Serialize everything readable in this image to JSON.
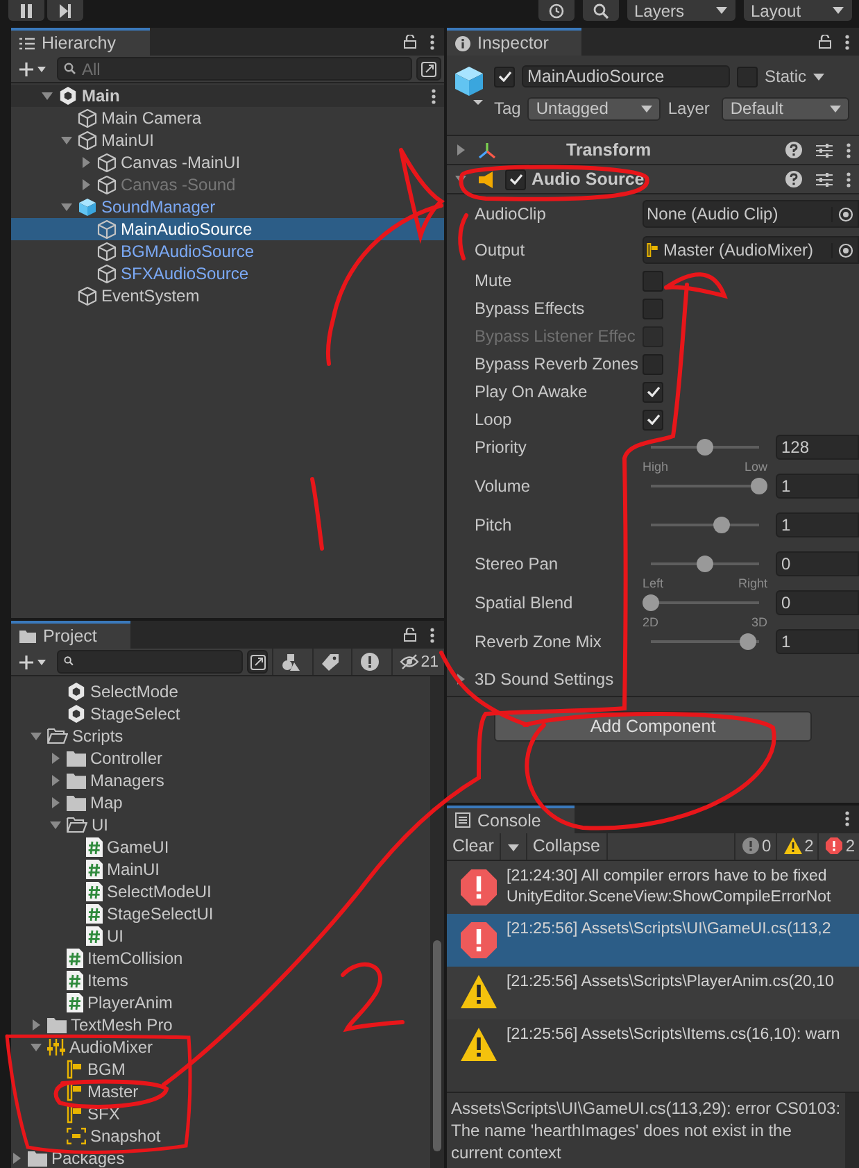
{
  "toolbar": {
    "layers": "Layers",
    "layout": "Layout"
  },
  "hierarchy": {
    "tab": "Hierarchy",
    "search": {
      "placeholder": "All"
    },
    "tree": [
      {
        "label": "Main",
        "kind": "scene",
        "expanded": true,
        "selected": false,
        "prefab_instance": false,
        "inactive": false,
        "children": [
          {
            "label": "Main Camera",
            "kind": "object",
            "selected": false,
            "prefab_instance": false,
            "inactive": false
          },
          {
            "label": "MainUI",
            "kind": "object",
            "expanded": true,
            "selected": false,
            "prefab_instance": false,
            "inactive": false,
            "children": [
              {
                "label": "Canvas -MainUI",
                "kind": "object",
                "expanded": false,
                "selected": false,
                "prefab_instance": false,
                "inactive": false
              },
              {
                "label": "Canvas -Sound",
                "kind": "object",
                "expanded": false,
                "selected": false,
                "prefab_instance": false,
                "inactive": true
              }
            ]
          },
          {
            "label": "SoundManager",
            "kind": "prefab",
            "expanded": true,
            "selected": false,
            "prefab_instance": true,
            "inactive": false,
            "children": [
              {
                "label": "MainAudioSource",
                "kind": "object",
                "selected": true,
                "prefab_instance": true,
                "inactive": false
              },
              {
                "label": "BGMAudioSource",
                "kind": "object",
                "selected": false,
                "prefab_instance": true,
                "inactive": false
              },
              {
                "label": "SFXAudioSource",
                "kind": "object",
                "selected": false,
                "prefab_instance": true,
                "inactive": false
              }
            ]
          },
          {
            "label": "EventSystem",
            "kind": "object",
            "selected": false,
            "prefab_instance": false,
            "inactive": false
          }
        ]
      }
    ]
  },
  "project": {
    "tab": "Project",
    "hidden_count": "21",
    "tree": [
      {
        "children": [
          {
            "children": [
              {
                "label": "SelectMode",
                "kind": "scene"
              },
              {
                "label": "StageSelect",
                "kind": "scene"
              }
            ]
          },
          {
            "label": "Scripts",
            "kind": "folder",
            "expanded": true,
            "children": [
              {
                "label": "Controller",
                "kind": "folder",
                "expanded": false
              },
              {
                "label": "Managers",
                "kind": "folder",
                "expanded": false
              },
              {
                "label": "Map",
                "kind": "folder",
                "expanded": false
              },
              {
                "label": "UI",
                "kind": "folder",
                "expanded": true,
                "children": [
                  {
                    "label": "GameUI",
                    "kind": "script"
                  },
                  {
                    "label": "MainUI",
                    "kind": "script"
                  },
                  {
                    "label": "SelectModeUI",
                    "kind": "script"
                  },
                  {
                    "label": "StageSelectUI",
                    "kind": "script"
                  },
                  {
                    "label": "UI",
                    "kind": "script"
                  }
                ]
              },
              {
                "label": "ItemCollision",
                "kind": "script"
              },
              {
                "label": "Items",
                "kind": "script"
              },
              {
                "label": "PlayerAnim",
                "kind": "script"
              }
            ]
          },
          {
            "label": "TextMesh Pro",
            "kind": "folder",
            "expanded": false
          },
          {
            "label": "AudioMixer",
            "kind": "mixer",
            "expanded": true,
            "children": [
              {
                "label": "BGM",
                "kind": "group"
              },
              {
                "label": "Master",
                "kind": "group"
              },
              {
                "label": "SFX",
                "kind": "group"
              },
              {
                "label": "Snapshot",
                "kind": "snapshot"
              }
            ]
          }
        ]
      },
      {
        "label": "Packages",
        "kind": "folder",
        "expanded": false
      }
    ]
  },
  "inspector": {
    "tab": "Inspector",
    "object": {
      "active": true,
      "name": "MainAudioSource",
      "static_label": "Static",
      "static": false,
      "tag_label": "Tag",
      "tag": "Untagged",
      "layer_label": "Layer",
      "layer": "Default"
    },
    "components": [
      {
        "name": "Transform",
        "kind": "transform",
        "expanded": false
      },
      {
        "name": "Audio Source",
        "kind": "audio",
        "expanded": true,
        "enabled": true,
        "properties": [
          {
            "kind": "object",
            "label": "AudioClip",
            "value": "None (Audio Clip)",
            "asset": false
          },
          {
            "kind": "object",
            "label": "Output",
            "value": "Master (AudioMixer)",
            "asset": true
          },
          {
            "kind": "toggle",
            "label": "Mute",
            "checked": false,
            "disabled": false
          },
          {
            "kind": "toggle",
            "label": "Bypass Effects",
            "checked": false,
            "disabled": false
          },
          {
            "kind": "toggle",
            "label": "Bypass Listener Effec",
            "checked": false,
            "disabled": true
          },
          {
            "kind": "toggle",
            "label": "Bypass Reverb Zones",
            "checked": false,
            "disabled": false
          },
          {
            "kind": "toggle",
            "label": "Play On Awake",
            "checked": true,
            "disabled": false
          },
          {
            "kind": "toggle",
            "label": "Loop",
            "checked": true,
            "disabled": false
          },
          {
            "kind": "slider",
            "label": "Priority",
            "level": 0.5,
            "value": "128",
            "min_label": "High",
            "max_label": "Low"
          },
          {
            "kind": "slider",
            "label": "Volume",
            "level": 1,
            "value": "1"
          },
          {
            "kind": "slider",
            "label": "Pitch",
            "level": 0.65,
            "value": "1"
          },
          {
            "kind": "slider",
            "label": "Stereo Pan",
            "level": 0.5,
            "value": "0",
            "min_label": "Left",
            "max_label": "Right"
          },
          {
            "kind": "slider",
            "label": "Spatial Blend",
            "level": 0,
            "value": "0",
            "min_label": "2D",
            "max_label": "3D"
          },
          {
            "kind": "slider",
            "label": "Reverb Zone Mix",
            "level": 0.9,
            "value": "1"
          },
          {
            "kind": "foldout",
            "label": "3D Sound Settings",
            "expanded": false
          }
        ]
      }
    ],
    "add_component": "Add Component"
  },
  "console": {
    "tab": "Console",
    "clear": "Clear",
    "collapse": "Collapse",
    "counts": [
      {
        "kind": "info",
        "count": "0"
      },
      {
        "kind": "warning",
        "count": "2"
      },
      {
        "kind": "error",
        "count": "2"
      }
    ],
    "entries": [
      {
        "kind": "error",
        "selected": false,
        "lines": [
          "[21:24:30] All compiler errors have to be fixed",
          "UnityEditor.SceneView:ShowCompileErrorNot"
        ]
      },
      {
        "kind": "error",
        "selected": true,
        "lines": [
          "[21:25:56] Assets\\Scripts\\UI\\GameUI.cs(113,2"
        ]
      },
      {
        "kind": "warning",
        "selected": false,
        "lines": [
          "[21:25:56] Assets\\Scripts\\PlayerAnim.cs(20,10"
        ]
      },
      {
        "kind": "warning",
        "selected": false,
        "lines": [
          "[21:25:56] Assets\\Scripts\\Items.cs(16,10): warn"
        ]
      }
    ],
    "detail": "Assets\\Scripts\\UI\\GameUI.cs(113,29): error CS0103: The name 'hearthImages' does not exist in the current context"
  }
}
